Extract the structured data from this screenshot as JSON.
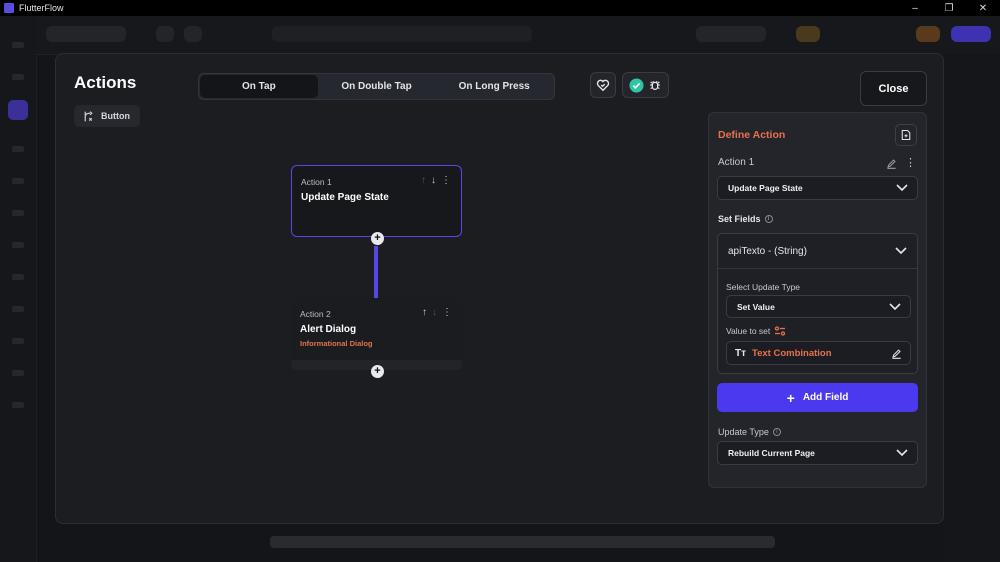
{
  "window": {
    "title": "FlutterFlow",
    "minimize": "–",
    "restore": "❐",
    "close": "✕"
  },
  "modal": {
    "title": "Actions",
    "trigger_label": "Button",
    "tabs": [
      {
        "label": "On Tap",
        "active": true
      },
      {
        "label": "On Double Tap",
        "active": false
      },
      {
        "label": "On Long Press",
        "active": false
      }
    ],
    "close_label": "Close"
  },
  "flow": {
    "actions": [
      {
        "label": "Action 1",
        "title": "Update Page State",
        "subtitle": ""
      },
      {
        "label": "Action 2",
        "title": "Alert Dialog",
        "subtitle": "Informational Dialog"
      }
    ],
    "add_symbol": "+"
  },
  "define_action": {
    "heading": "Define Action",
    "action_label": "Action 1",
    "action_value": "Update Page State",
    "set_fields_label": "Set Fields",
    "field_name": "apiTexto - (String)",
    "select_update_type_label": "Select Update Type",
    "update_type_value": "Set Value",
    "value_to_set_label": "Value to set",
    "value_text": "Text Combination",
    "add_field_label": "Add Field",
    "update_type_label": "Update Type",
    "update_type_selected": "Rebuild Current Page"
  },
  "colors": {
    "accent": "#4b39ef",
    "orange": "#e8714d",
    "selected_border": "#5648e8"
  }
}
